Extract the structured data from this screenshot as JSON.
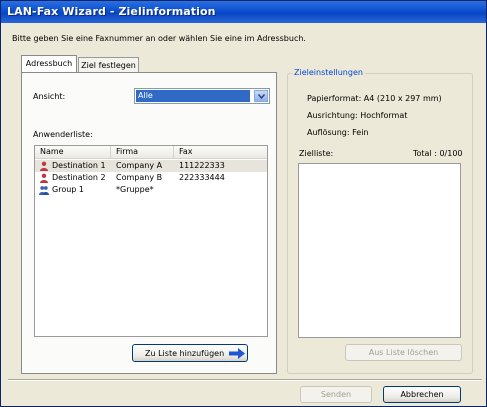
{
  "window": {
    "title": "LAN-Fax Wizard - Zielinformation"
  },
  "instruction": "Bitte geben Sie eine Faxnummer an oder wählen Sie eine im Adressbuch.",
  "tabs": [
    {
      "label": "Adressbuch",
      "active": true
    },
    {
      "label": "Ziel festlegen",
      "active": false
    }
  ],
  "address_book": {
    "view_label": "Ansicht:",
    "view_value": "Alle",
    "user_list_label": "Anwenderliste:",
    "columns": [
      "Name",
      "Firma",
      "Fax"
    ],
    "rows": [
      {
        "icon": "user-icon",
        "name": "Destination 1",
        "company": "Company A",
        "fax": "111222333",
        "selected": true
      },
      {
        "icon": "user-icon",
        "name": "Destination 2",
        "company": "Company B",
        "fax": "222333444",
        "selected": false
      },
      {
        "icon": "group-icon",
        "name": "Group 1",
        "company": "*Gruppe*",
        "fax": "",
        "selected": false
      }
    ],
    "add_button": "Zu Liste hinzufügen",
    "add_button_icon": "arrow-right-icon"
  },
  "destination_settings": {
    "legend": "Zieleinstellungen",
    "paper_format": "Papierformat: A4 (210 x 297 mm)",
    "orientation": "Ausrichtung: Hochformat",
    "resolution": "Auflösung: Fein",
    "list_label": "Zielliste:",
    "total": "Total : 0/100",
    "remove_button": "Aus Liste löschen"
  },
  "footer": {
    "send": "Senden",
    "cancel": "Abbrechen"
  },
  "colors": {
    "titlebar": "#0a4fd0",
    "selection": "#316ac5",
    "legend": "#0046d5",
    "arrow": "#1f56d6"
  }
}
